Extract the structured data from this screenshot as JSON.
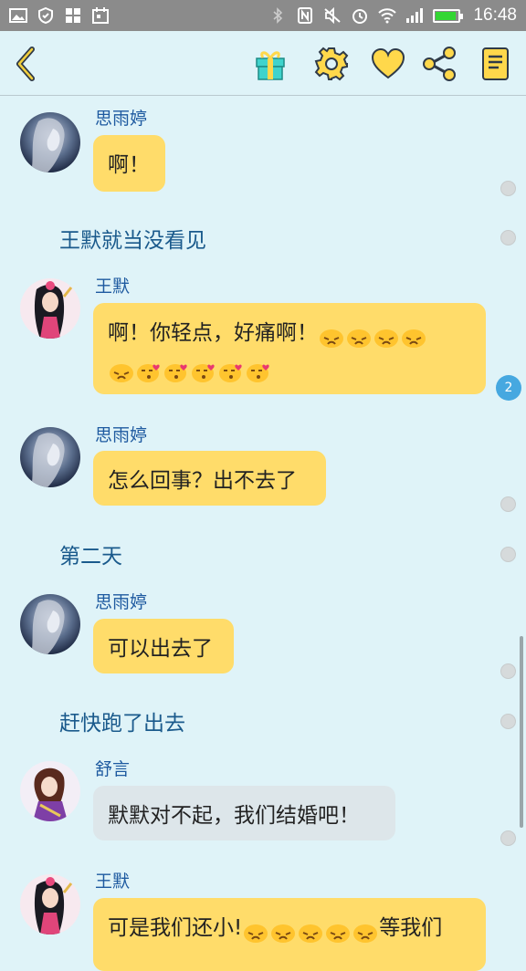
{
  "status_bar": {
    "time": "16:48",
    "battery_level": 0.9
  },
  "toolbar": {
    "back": "back-icon",
    "gift": "gift-icon",
    "settings": "gear-icon",
    "favorite": "heart-icon",
    "share": "share-icon",
    "notes": "notebook-icon"
  },
  "colors": {
    "accent": "#ffdc6a",
    "background": "#dff3f8",
    "link": "#1e5aa0"
  },
  "messages": [
    {
      "sender": "思雨婷",
      "text": "啊！"
    },
    {
      "narration": "王默就当没看见"
    },
    {
      "sender": "王默",
      "text_line1": "啊！你轻点，好痛啊！",
      "unread": "2"
    },
    {
      "sender": "思雨婷",
      "text": "怎么回事？出不去了"
    },
    {
      "narration": "第二天"
    },
    {
      "sender": "思雨婷",
      "text": "可以出去了"
    },
    {
      "narration": "赶快跑了出去"
    },
    {
      "sender": "舒言",
      "text": "默默对不起，我们结婚吧！"
    },
    {
      "sender": "王默",
      "text_a": "可是我们还小!",
      "text_b": "等我们"
    }
  ]
}
